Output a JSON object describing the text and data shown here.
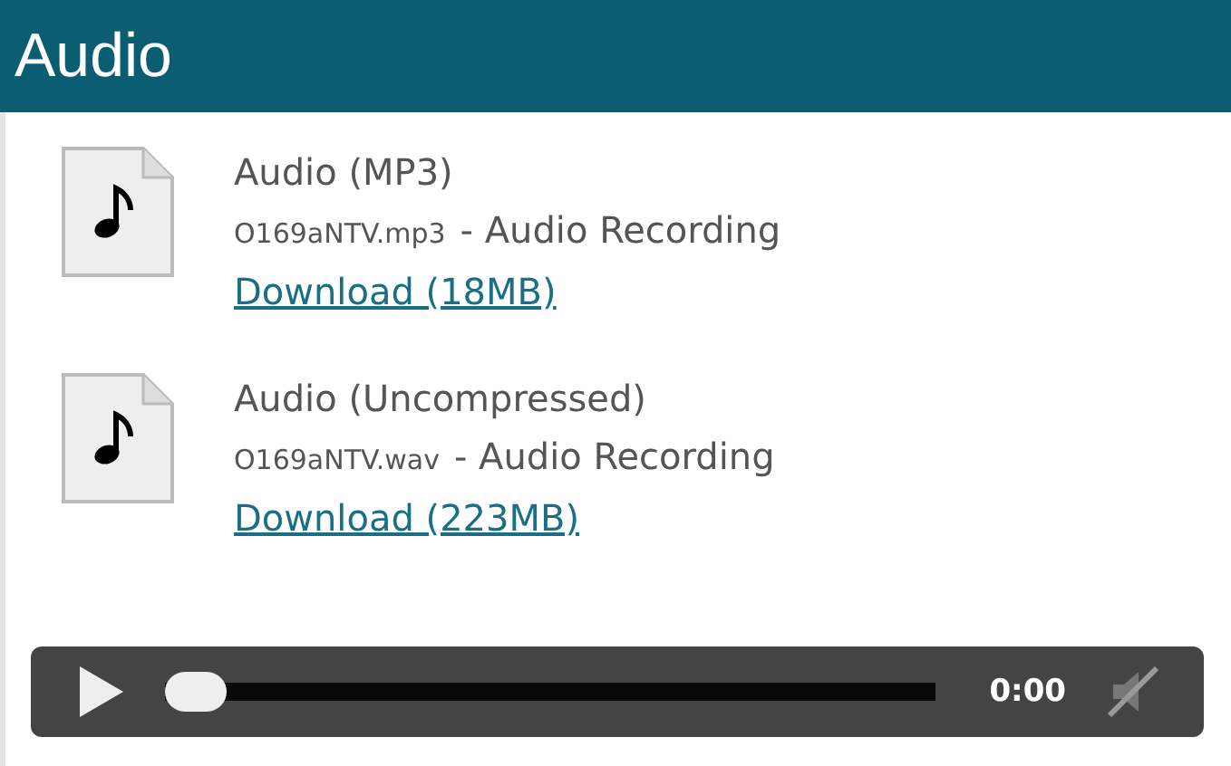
{
  "header": {
    "title": "Audio"
  },
  "files": [
    {
      "title": "Audio (MP3)",
      "filename": "O169aNTV.mp3",
      "description": "- Audio Recording",
      "link": "Download (18MB)"
    },
    {
      "title": "Audio (Uncompressed)",
      "filename": "O169aNTV.wav",
      "description": "- Audio Recording",
      "link": "Download (223MB)"
    }
  ],
  "player": {
    "time": "0:00",
    "level": 0,
    "muted": true
  }
}
